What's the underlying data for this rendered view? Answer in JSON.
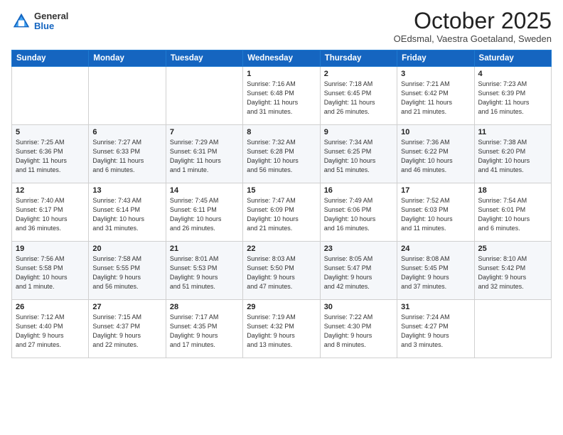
{
  "header": {
    "logo": {
      "general": "General",
      "blue": "Blue"
    },
    "title": "October 2025",
    "location": "OEdsmal, Vaestra Goetaland, Sweden"
  },
  "weekdays": [
    "Sunday",
    "Monday",
    "Tuesday",
    "Wednesday",
    "Thursday",
    "Friday",
    "Saturday"
  ],
  "weeks": [
    [
      {
        "day": "",
        "info": ""
      },
      {
        "day": "",
        "info": ""
      },
      {
        "day": "",
        "info": ""
      },
      {
        "day": "1",
        "info": "Sunrise: 7:16 AM\nSunset: 6:48 PM\nDaylight: 11 hours\nand 31 minutes."
      },
      {
        "day": "2",
        "info": "Sunrise: 7:18 AM\nSunset: 6:45 PM\nDaylight: 11 hours\nand 26 minutes."
      },
      {
        "day": "3",
        "info": "Sunrise: 7:21 AM\nSunset: 6:42 PM\nDaylight: 11 hours\nand 21 minutes."
      },
      {
        "day": "4",
        "info": "Sunrise: 7:23 AM\nSunset: 6:39 PM\nDaylight: 11 hours\nand 16 minutes."
      }
    ],
    [
      {
        "day": "5",
        "info": "Sunrise: 7:25 AM\nSunset: 6:36 PM\nDaylight: 11 hours\nand 11 minutes."
      },
      {
        "day": "6",
        "info": "Sunrise: 7:27 AM\nSunset: 6:33 PM\nDaylight: 11 hours\nand 6 minutes."
      },
      {
        "day": "7",
        "info": "Sunrise: 7:29 AM\nSunset: 6:31 PM\nDaylight: 11 hours\nand 1 minute."
      },
      {
        "day": "8",
        "info": "Sunrise: 7:32 AM\nSunset: 6:28 PM\nDaylight: 10 hours\nand 56 minutes."
      },
      {
        "day": "9",
        "info": "Sunrise: 7:34 AM\nSunset: 6:25 PM\nDaylight: 10 hours\nand 51 minutes."
      },
      {
        "day": "10",
        "info": "Sunrise: 7:36 AM\nSunset: 6:22 PM\nDaylight: 10 hours\nand 46 minutes."
      },
      {
        "day": "11",
        "info": "Sunrise: 7:38 AM\nSunset: 6:20 PM\nDaylight: 10 hours\nand 41 minutes."
      }
    ],
    [
      {
        "day": "12",
        "info": "Sunrise: 7:40 AM\nSunset: 6:17 PM\nDaylight: 10 hours\nand 36 minutes."
      },
      {
        "day": "13",
        "info": "Sunrise: 7:43 AM\nSunset: 6:14 PM\nDaylight: 10 hours\nand 31 minutes."
      },
      {
        "day": "14",
        "info": "Sunrise: 7:45 AM\nSunset: 6:11 PM\nDaylight: 10 hours\nand 26 minutes."
      },
      {
        "day": "15",
        "info": "Sunrise: 7:47 AM\nSunset: 6:09 PM\nDaylight: 10 hours\nand 21 minutes."
      },
      {
        "day": "16",
        "info": "Sunrise: 7:49 AM\nSunset: 6:06 PM\nDaylight: 10 hours\nand 16 minutes."
      },
      {
        "day": "17",
        "info": "Sunrise: 7:52 AM\nSunset: 6:03 PM\nDaylight: 10 hours\nand 11 minutes."
      },
      {
        "day": "18",
        "info": "Sunrise: 7:54 AM\nSunset: 6:01 PM\nDaylight: 10 hours\nand 6 minutes."
      }
    ],
    [
      {
        "day": "19",
        "info": "Sunrise: 7:56 AM\nSunset: 5:58 PM\nDaylight: 10 hours\nand 1 minute."
      },
      {
        "day": "20",
        "info": "Sunrise: 7:58 AM\nSunset: 5:55 PM\nDaylight: 9 hours\nand 56 minutes."
      },
      {
        "day": "21",
        "info": "Sunrise: 8:01 AM\nSunset: 5:53 PM\nDaylight: 9 hours\nand 51 minutes."
      },
      {
        "day": "22",
        "info": "Sunrise: 8:03 AM\nSunset: 5:50 PM\nDaylight: 9 hours\nand 47 minutes."
      },
      {
        "day": "23",
        "info": "Sunrise: 8:05 AM\nSunset: 5:47 PM\nDaylight: 9 hours\nand 42 minutes."
      },
      {
        "day": "24",
        "info": "Sunrise: 8:08 AM\nSunset: 5:45 PM\nDaylight: 9 hours\nand 37 minutes."
      },
      {
        "day": "25",
        "info": "Sunrise: 8:10 AM\nSunset: 5:42 PM\nDaylight: 9 hours\nand 32 minutes."
      }
    ],
    [
      {
        "day": "26",
        "info": "Sunrise: 7:12 AM\nSunset: 4:40 PM\nDaylight: 9 hours\nand 27 minutes."
      },
      {
        "day": "27",
        "info": "Sunrise: 7:15 AM\nSunset: 4:37 PM\nDaylight: 9 hours\nand 22 minutes."
      },
      {
        "day": "28",
        "info": "Sunrise: 7:17 AM\nSunset: 4:35 PM\nDaylight: 9 hours\nand 17 minutes."
      },
      {
        "day": "29",
        "info": "Sunrise: 7:19 AM\nSunset: 4:32 PM\nDaylight: 9 hours\nand 13 minutes."
      },
      {
        "day": "30",
        "info": "Sunrise: 7:22 AM\nSunset: 4:30 PM\nDaylight: 9 hours\nand 8 minutes."
      },
      {
        "day": "31",
        "info": "Sunrise: 7:24 AM\nSunset: 4:27 PM\nDaylight: 9 hours\nand 3 minutes."
      },
      {
        "day": "",
        "info": ""
      }
    ]
  ]
}
